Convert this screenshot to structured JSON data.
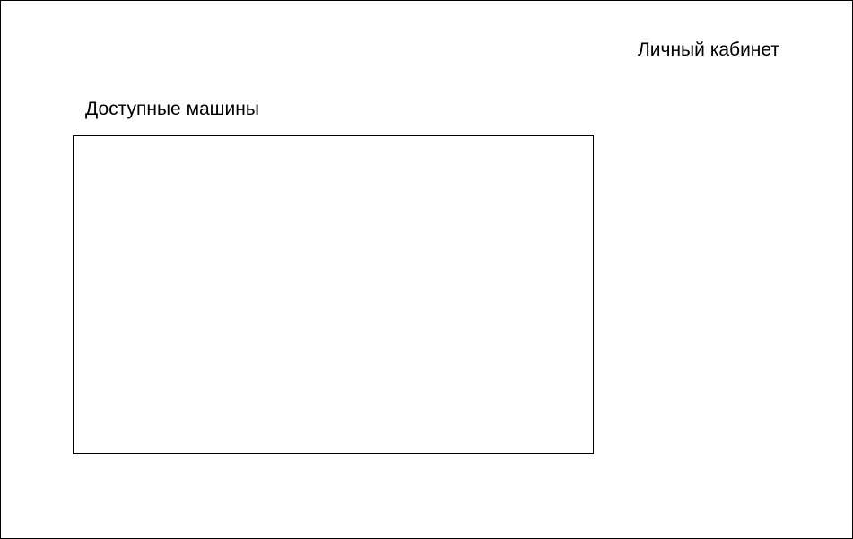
{
  "header": {
    "account_link": "Личный кабинет"
  },
  "main": {
    "section_title": "Доступные машины",
    "machines": []
  }
}
